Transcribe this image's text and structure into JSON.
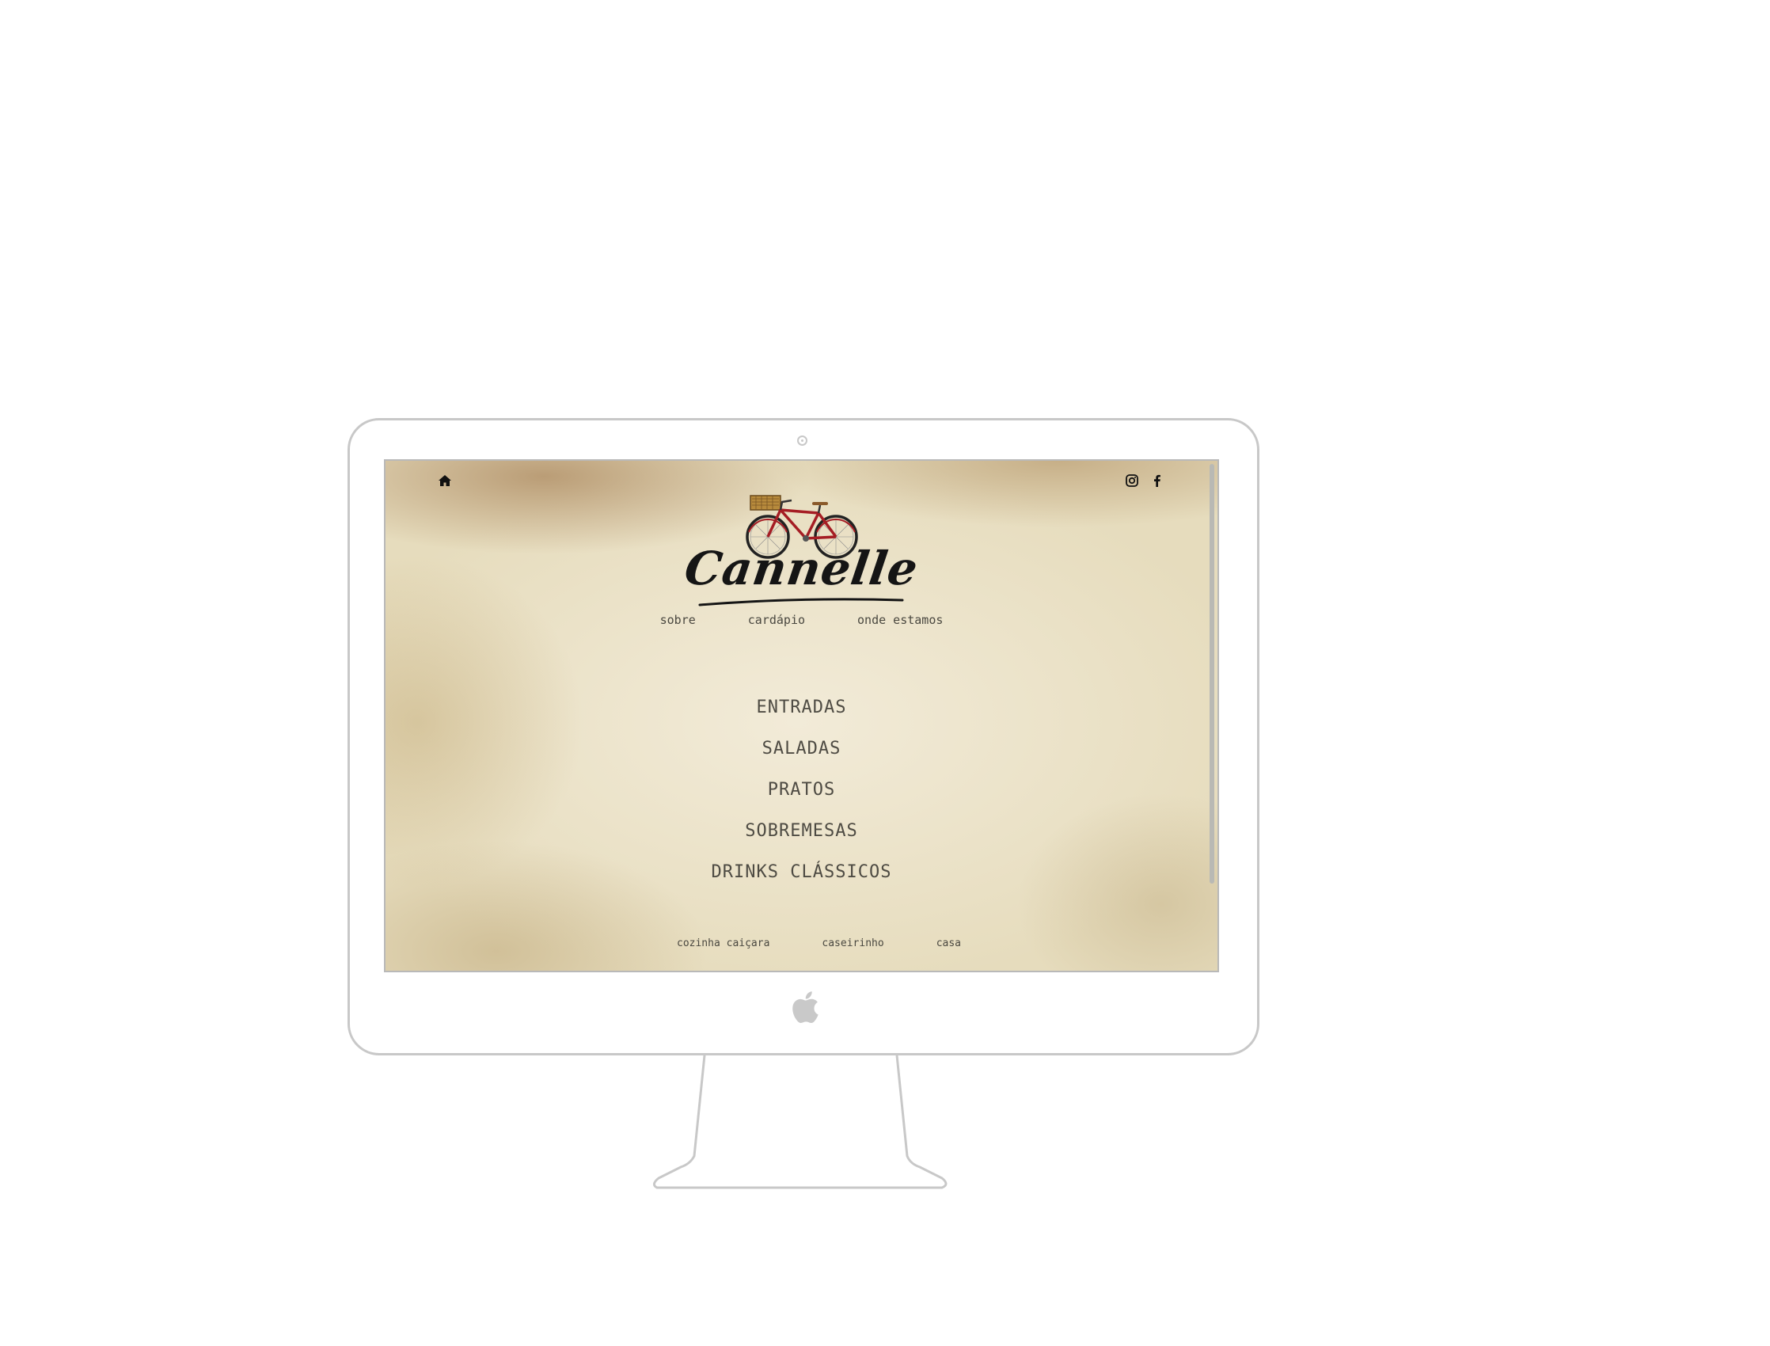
{
  "site": {
    "brand": "Cannelle",
    "icons": {
      "home": "home-icon",
      "instagram": "instagram-icon",
      "facebook": "facebook-icon",
      "logo": "bicycle-icon"
    },
    "top_nav": [
      "sobre",
      "cardápio",
      "onde estamos"
    ],
    "menu": [
      "ENTRADAS",
      "SALADAS",
      "PRATOS",
      "SOBREMESAS",
      "DRINKS CLÁSSICOS"
    ],
    "footer_nav": [
      "cozinha caiçara",
      "caseirinho",
      "casa"
    ]
  },
  "colors": {
    "paper": "#ece3c8",
    "text": "#4e4b43",
    "bike_frame": "#a51d24",
    "basket": "#b78a3c"
  }
}
